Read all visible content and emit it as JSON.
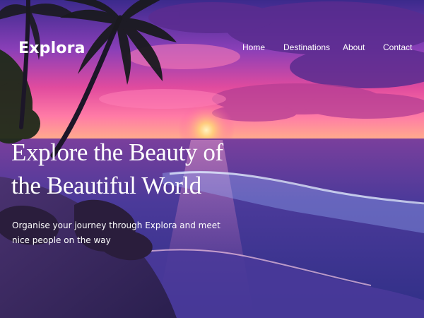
{
  "brand": {
    "logo_text": "Explora"
  },
  "nav": {
    "items": [
      {
        "label": "Home"
      },
      {
        "label": "Destinations"
      },
      {
        "label": "About"
      },
      {
        "label": "Contact"
      }
    ]
  },
  "hero": {
    "headline_line1": "Explore the Beauty of",
    "headline_line2": "the Beautiful World",
    "tagline": "Organise your journey through Explora and meet nice people on the way"
  },
  "colors": {
    "sky_top": "#3b2a8c",
    "sunset_pink": "#ff5aa8",
    "sun_glow": "#ffd27a",
    "ocean": "#3a2f8a",
    "text": "#ffffff"
  }
}
